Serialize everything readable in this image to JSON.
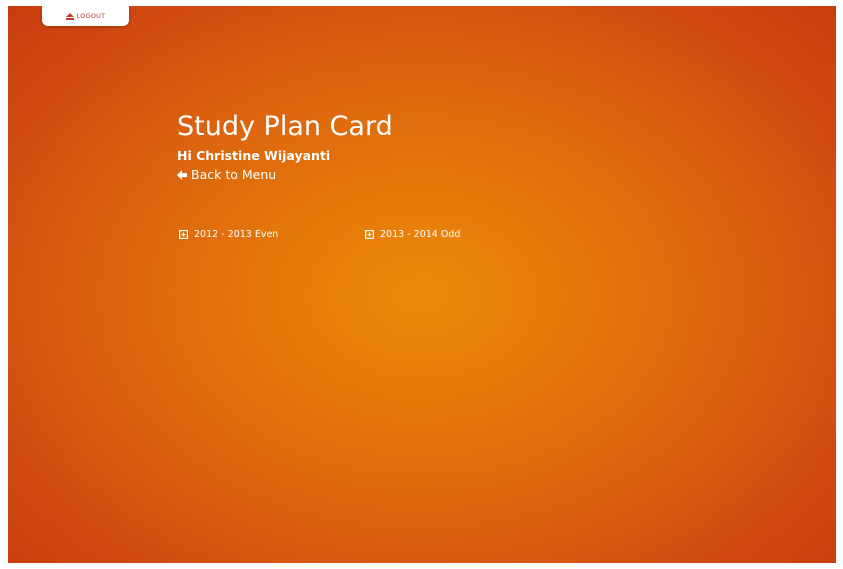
{
  "header": {
    "logout_label": "LOGOUT",
    "logout_icon": "eject-icon"
  },
  "page": {
    "title": "Study Plan Card",
    "greeting": "Hi Christine Wijayanti",
    "back_label": "Back to Menu",
    "back_icon": "arrow-left-icon"
  },
  "terms": [
    {
      "label": "2012 - 2013 Even",
      "icon": "plus-square-icon"
    },
    {
      "label": "2013 - 2014 Odd",
      "icon": "plus-square-icon"
    }
  ],
  "colors": {
    "background_center": "#ec8a0a",
    "background_edge": "#c83d10",
    "logout_text": "#c0392b",
    "text": "#ffffff"
  }
}
